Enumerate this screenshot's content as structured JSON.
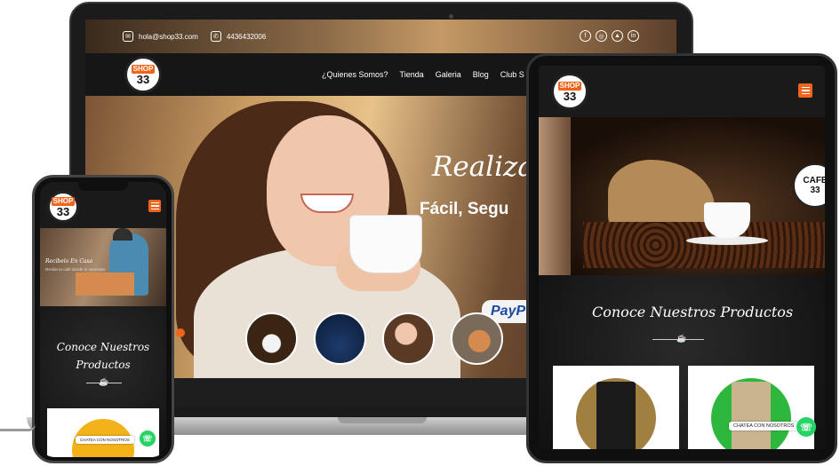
{
  "laptop": {
    "topbar": {
      "email": "hola@shop33.com",
      "phone": "4436432006",
      "socials": [
        "f",
        "◎",
        "▲",
        "in"
      ]
    },
    "logo": {
      "line1": "SHOP",
      "line2": "33"
    },
    "menu": [
      "¿Quienes Somos?",
      "Tienda",
      "Galeria",
      "Blog",
      "Club S"
    ],
    "hero": {
      "title": "Realiza",
      "subtitle": "Fácil, Segu",
      "payment": "PayP"
    }
  },
  "tablet": {
    "logo": {
      "line1": "SHOP",
      "line2": "33"
    },
    "badge": {
      "line1": "CAFE",
      "line2": "33"
    },
    "products_title": "Conoce Nuestros Productos",
    "chat_label": "CHATEA CON NOSOTROS",
    "whatsapp_icon": "☏"
  },
  "phone": {
    "logo": {
      "line1": "SHOP",
      "line2": "33"
    },
    "hero_text": "Recíbelo En Casa",
    "hero_sub": "Recibe tu café donde lo necesites",
    "products_title_1": "Conoce Nuestros",
    "products_title_2": "Productos",
    "chat_label": "CHATEA CON NOSOTROS",
    "whatsapp_icon": "☏"
  },
  "colors": {
    "accent": "#f0641c",
    "whatsapp": "#25d366",
    "dark": "#1a1a1a"
  }
}
